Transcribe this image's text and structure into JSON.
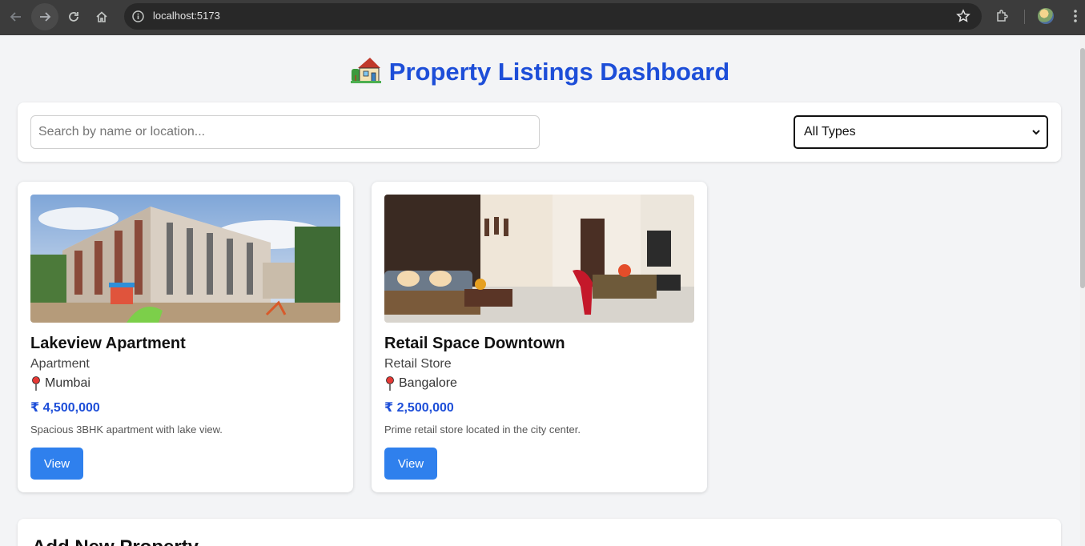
{
  "browser": {
    "url": "localhost:5173"
  },
  "page": {
    "title_emoji_icon": "house-with-garden-icon",
    "title": "Property Listings Dashboard",
    "search": {
      "placeholder": "Search by name or location...",
      "value": ""
    },
    "type_filter": {
      "selected": "All Types"
    },
    "listings": [
      {
        "name": "Lakeview Apartment",
        "type": "Apartment",
        "location": "Mumbai",
        "price": "₹ 4,500,000",
        "description": "Spacious 3BHK apartment with lake view.",
        "button": "View",
        "image": "apartment-building-photo"
      },
      {
        "name": "Retail Space Downtown",
        "type": "Retail Store",
        "location": "Bangalore",
        "price": "₹ 2,500,000",
        "description": "Prime retail store located in the city center.",
        "button": "View",
        "image": "furnished-interior-photo"
      }
    ],
    "add_section": {
      "heading": "Add New Property"
    }
  },
  "colors": {
    "accent": "#1d4ed8",
    "button": "#2f80ed",
    "background": "#f3f4f6"
  }
}
